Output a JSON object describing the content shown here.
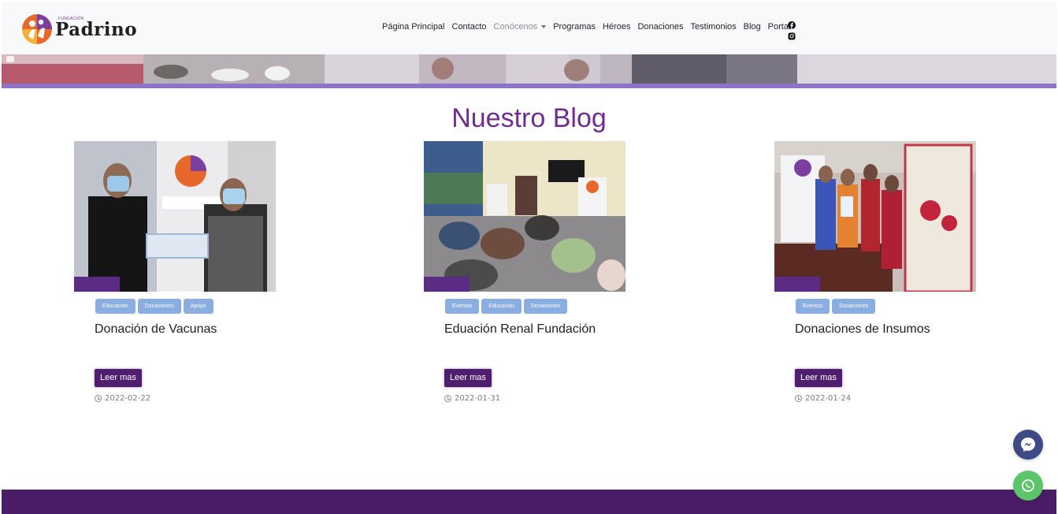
{
  "header": {
    "logo": {
      "small_text": "FUNDACIÓN",
      "name": "Padrino"
    },
    "nav": {
      "items": [
        {
          "label": "Página Principal"
        },
        {
          "label": "Contacto"
        },
        {
          "label": "Conócenos",
          "dropdown": true
        },
        {
          "label": "Programas"
        },
        {
          "label": "Héroes"
        },
        {
          "label": "Donaciones"
        },
        {
          "label": "Testimonios"
        },
        {
          "label": "Blog"
        },
        {
          "label": "Portal"
        }
      ]
    },
    "social_icons": [
      "facebook-icon",
      "instagram-icon"
    ]
  },
  "main": {
    "title": "Nuestro Blog",
    "posts": [
      {
        "title": "Donación de Vacunas",
        "tags": [
          "Educación",
          "Donaciones",
          "Apoyo"
        ],
        "button": "Leer mas",
        "date": "2022-02-22"
      },
      {
        "title": "Eduación Renal Fundación",
        "tags": [
          "Eventos",
          "Educación",
          "Donaciones"
        ],
        "button": "Leer mas",
        "date": "2022-01-31"
      },
      {
        "title": "Donaciones de Insumos",
        "tags": [
          "Eventos",
          "Donaciones"
        ],
        "button": "Leer mas",
        "date": "2022-01-24"
      }
    ]
  },
  "floating": [
    "messenger-icon",
    "whatsapp-icon"
  ],
  "colors": {
    "brand_purple": "#6f2c91",
    "button_purple": "#4f1f6e",
    "tag_blue": "#8aaedf",
    "footer": "#4b1d67",
    "whatsapp": "#5cc46a",
    "messenger": "#3d4a86"
  }
}
